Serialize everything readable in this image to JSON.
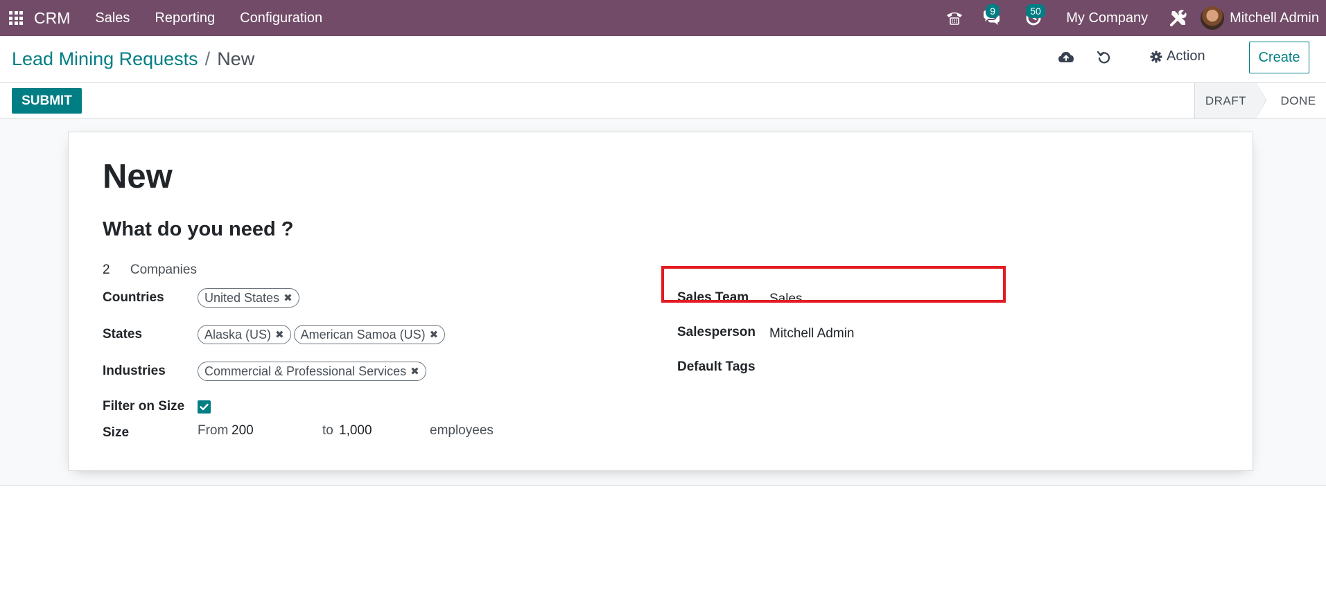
{
  "navbar": {
    "app_name": "CRM",
    "menu": [
      "Sales",
      "Reporting",
      "Configuration"
    ],
    "messages_count": "9",
    "activities_count": "50",
    "company": "My Company",
    "user": "Mitchell Admin"
  },
  "control_panel": {
    "breadcrumb_parent": "Lead Mining Requests",
    "breadcrumb_separator": "/",
    "breadcrumb_current": "New",
    "action_label": "Action",
    "create_label": "Create"
  },
  "status_bar": {
    "submit_label": "SUBMIT",
    "stages": [
      "DRAFT",
      "DONE"
    ],
    "current_stage": "DRAFT"
  },
  "form": {
    "title": "New",
    "section_title": "What do you need ?",
    "count": "2",
    "count_type": "Companies",
    "countries_label": "Countries",
    "countries": [
      "United States"
    ],
    "states_label": "States",
    "states": [
      "Alaska (US)",
      "American Samoa (US)"
    ],
    "industries_label": "Industries",
    "industries": [
      "Commercial & Professional Services"
    ],
    "filter_on_size_label": "Filter on Size",
    "filter_on_size": true,
    "size_label": "Size",
    "size_from_label": "From",
    "size_from": "200",
    "size_to_label": "to",
    "size_to": "1,000",
    "size_unit": "employees",
    "sales_team_label": "Sales Team",
    "sales_team": "Sales",
    "salesperson_label": "Salesperson",
    "salesperson": "Mitchell Admin",
    "default_tags_label": "Default Tags"
  },
  "colors": {
    "navbar": "#714b67",
    "primary": "#017e84",
    "highlight": "#e31b23"
  }
}
